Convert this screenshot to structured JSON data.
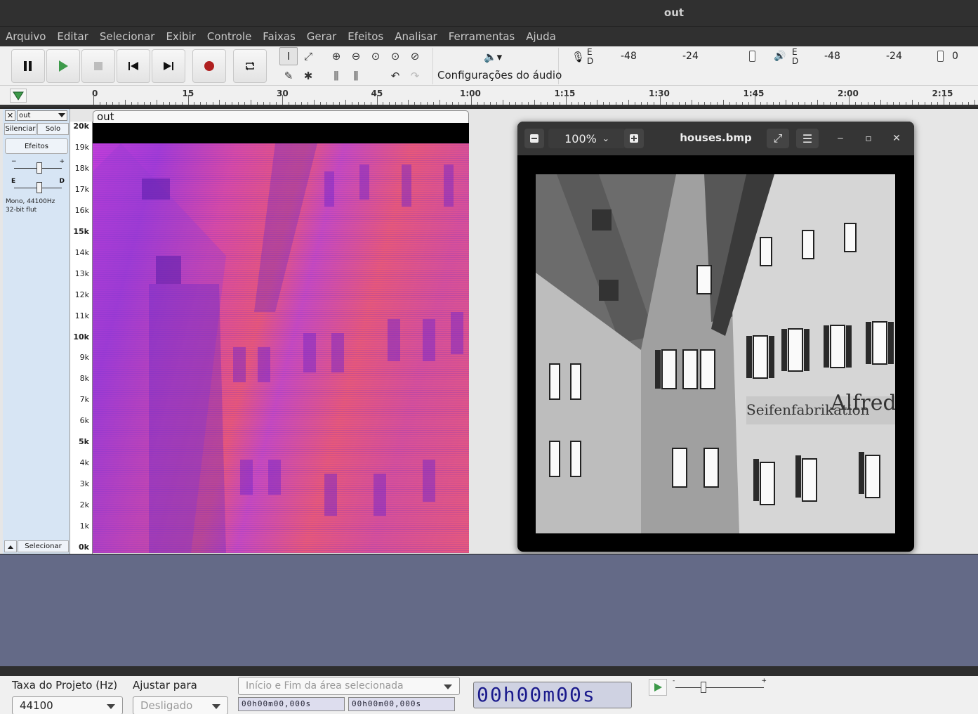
{
  "window": {
    "title": "out"
  },
  "menu": [
    "Arquivo",
    "Editar",
    "Selecionar",
    "Exibir",
    "Controle",
    "Faixas",
    "Gerar",
    "Efeitos",
    "Analisar",
    "Ferramentas",
    "Ajuda"
  ],
  "toolbar": {
    "audio_settings_label": "Configurações do áudio",
    "record_meter": {
      "channels": "E\nD",
      "ticks": [
        "-48",
        "-24"
      ]
    },
    "play_meter": {
      "channels": "E\nD",
      "ticks": [
        "-48",
        "-24",
        "0"
      ]
    }
  },
  "timeline": {
    "labels": [
      "0",
      "15",
      "30",
      "45",
      "1:00",
      "1:15",
      "1:30",
      "1:45",
      "2:00",
      "2:15"
    ]
  },
  "track": {
    "name": "out",
    "mute_label": "Silenciar",
    "solo_label": "Solo",
    "effects_label": "Efeitos",
    "gain_lo": "−",
    "gain_hi": "+",
    "pan_lo": "E",
    "pan_hi": "D",
    "info_line1": "Mono, 44100Hz",
    "info_line2": "32-bit flut",
    "select_label": "Selecionar",
    "clip_name": "out",
    "freq_labels": [
      "20k",
      "19k",
      "18k",
      "17k",
      "16k",
      "15k",
      "14k",
      "13k",
      "12k",
      "11k",
      "10k",
      "9k",
      "8k",
      "7k",
      "6k",
      "5k",
      "4k",
      "3k",
      "2k",
      "1k",
      "0k"
    ]
  },
  "viewer": {
    "zoom": "100%",
    "filename": "houses.bmp",
    "photo_text_1": "Seifenfabrikation",
    "photo_text_2": "Alfred"
  },
  "bottom": {
    "rate_label": "Taxa do Projeto (Hz)",
    "rate_value": "44100",
    "snap_label": "Ajustar para",
    "snap_value": "Desligado",
    "selection_label": "Início e Fim da área selecionada",
    "sel_start": "00h00m00,000s",
    "sel_end": "00h00m00,000s",
    "audio_position": "00h00m00s"
  },
  "colors": {
    "accent_record": "#b02020",
    "play_green": "#3d9a4a",
    "track_bg": "#d7e5f4"
  }
}
